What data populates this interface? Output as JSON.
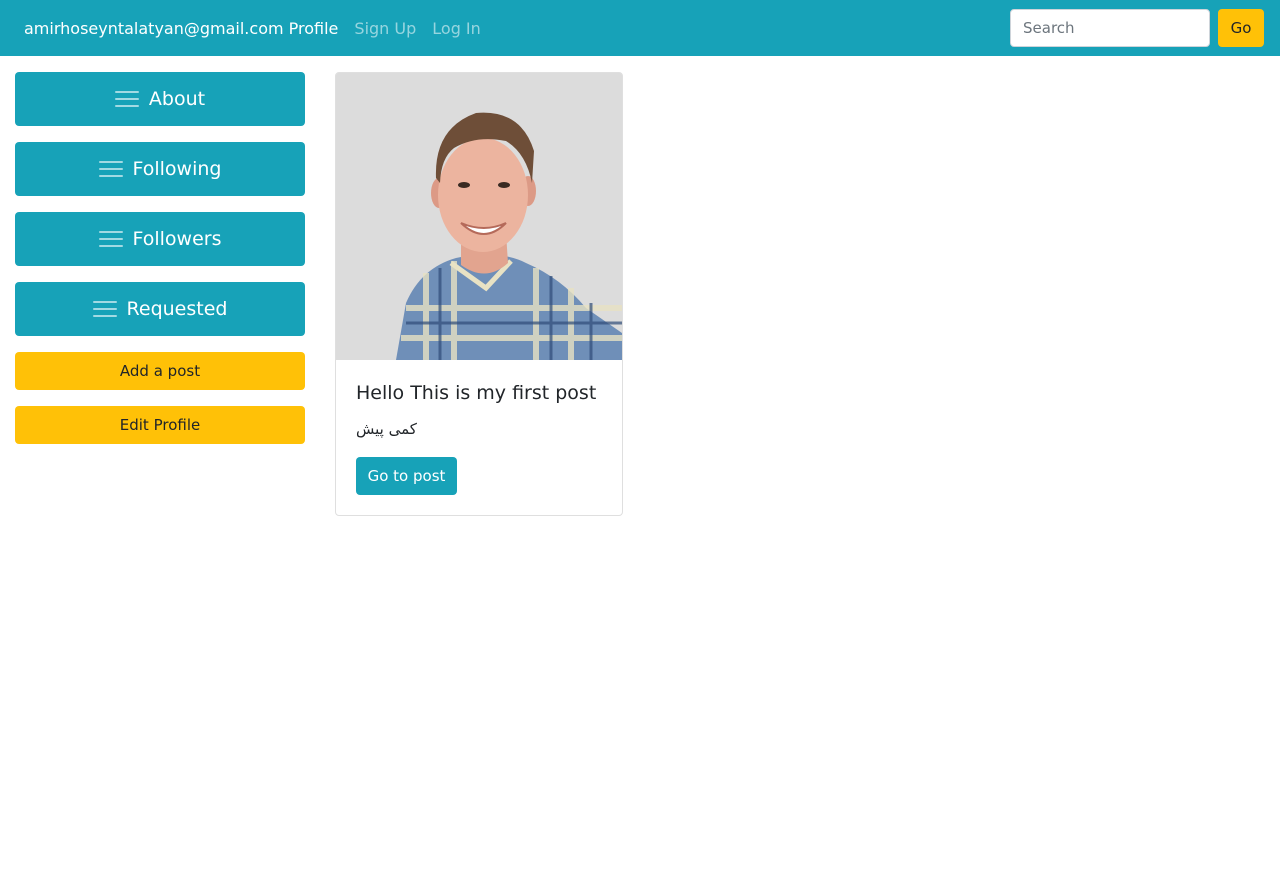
{
  "navbar": {
    "brand": "amirhoseyntalatyan@gmail.com Profile",
    "links": [
      "Sign Up",
      "Log In"
    ],
    "search_placeholder": "Search",
    "go_label": "Go"
  },
  "sidebar": {
    "menu_buttons": [
      {
        "label": "About",
        "icon": "menu-icon"
      },
      {
        "label": "Following",
        "icon": "menu-icon"
      },
      {
        "label": "Followers",
        "icon": "menu-icon"
      },
      {
        "label": "Requested",
        "icon": "menu-icon"
      }
    ],
    "add_post_label": "Add a post",
    "edit_profile_label": "Edit Profile"
  },
  "post_card": {
    "title": "Hello This is my first post",
    "text": "کمی پیش",
    "button_label": "Go to post",
    "image": "profile-photo"
  },
  "colors": {
    "primary": "#17a2b8",
    "warning": "#ffc107",
    "white": "#ffffff"
  }
}
